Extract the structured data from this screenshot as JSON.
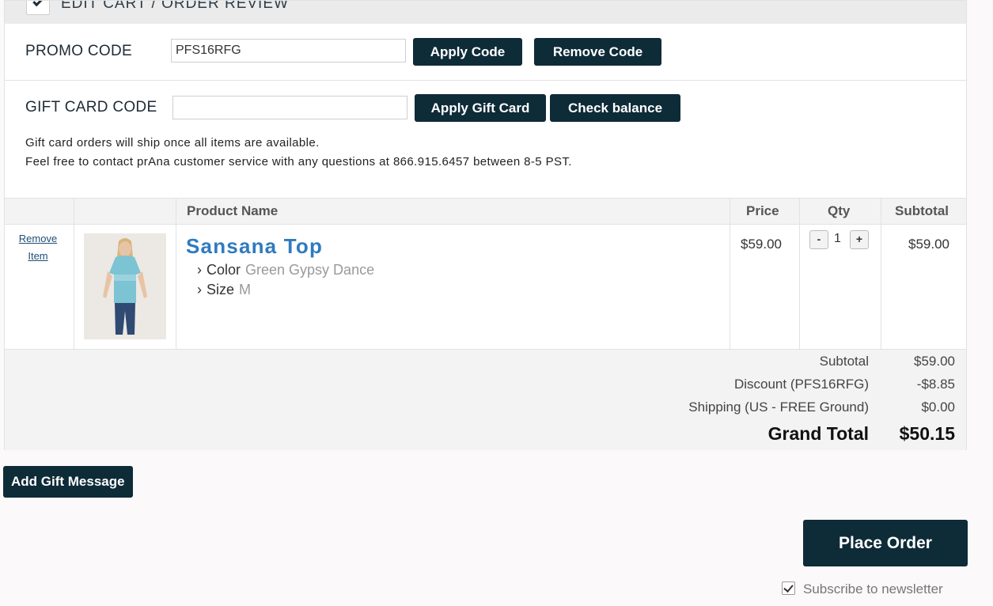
{
  "section": {
    "title": "EDIT CART / ORDER REVIEW"
  },
  "promo": {
    "label": "PROMO CODE",
    "value": "PFS16RFG",
    "apply_label": "Apply Code",
    "remove_label": "Remove Code"
  },
  "giftcard": {
    "label": "GIFT CARD CODE",
    "value": "",
    "apply_label": "Apply Gift Card",
    "check_label": "Check balance"
  },
  "notes": {
    "line1": "Gift card orders will ship once all items are available.",
    "line2": "Feel free to contact prAna customer service with any questions at 866.915.6457 between 8-5 PST."
  },
  "table": {
    "headers": {
      "product": "Product Name",
      "price": "Price",
      "qty": "Qty",
      "subtotal": "Subtotal"
    },
    "item": {
      "remove_line1": "Remove",
      "remove_line2": "Item",
      "name": "Sansana Top",
      "color_label": "Color",
      "color_value": "Green Gypsy Dance",
      "size_label": "Size",
      "size_value": "M",
      "price": "$59.00",
      "qty": "1",
      "qty_minus": "-",
      "qty_plus": "+",
      "subtotal": "$59.00"
    }
  },
  "totals": {
    "subtotal_label": "Subtotal",
    "subtotal_value": "$59.00",
    "discount_label": "Discount (PFS16RFG)",
    "discount_value": "-$8.85",
    "shipping_label": "Shipping (US - FREE Ground)",
    "shipping_value": "$0.00",
    "grand_label": "Grand Total",
    "grand_value": "$50.15"
  },
  "actions": {
    "gift_message_label": "Add Gift Message",
    "place_order_label": "Place Order"
  },
  "newsletter": {
    "label": "Subscribe to newsletter",
    "checked": true
  },
  "colors": {
    "button_bg": "#0e2b38",
    "link": "#2f7bbf",
    "table_bg": "#f3f3f3"
  },
  "icons": {
    "chevron": "chevron-right-icon",
    "checkbox": "checkbox-checked-icon"
  }
}
